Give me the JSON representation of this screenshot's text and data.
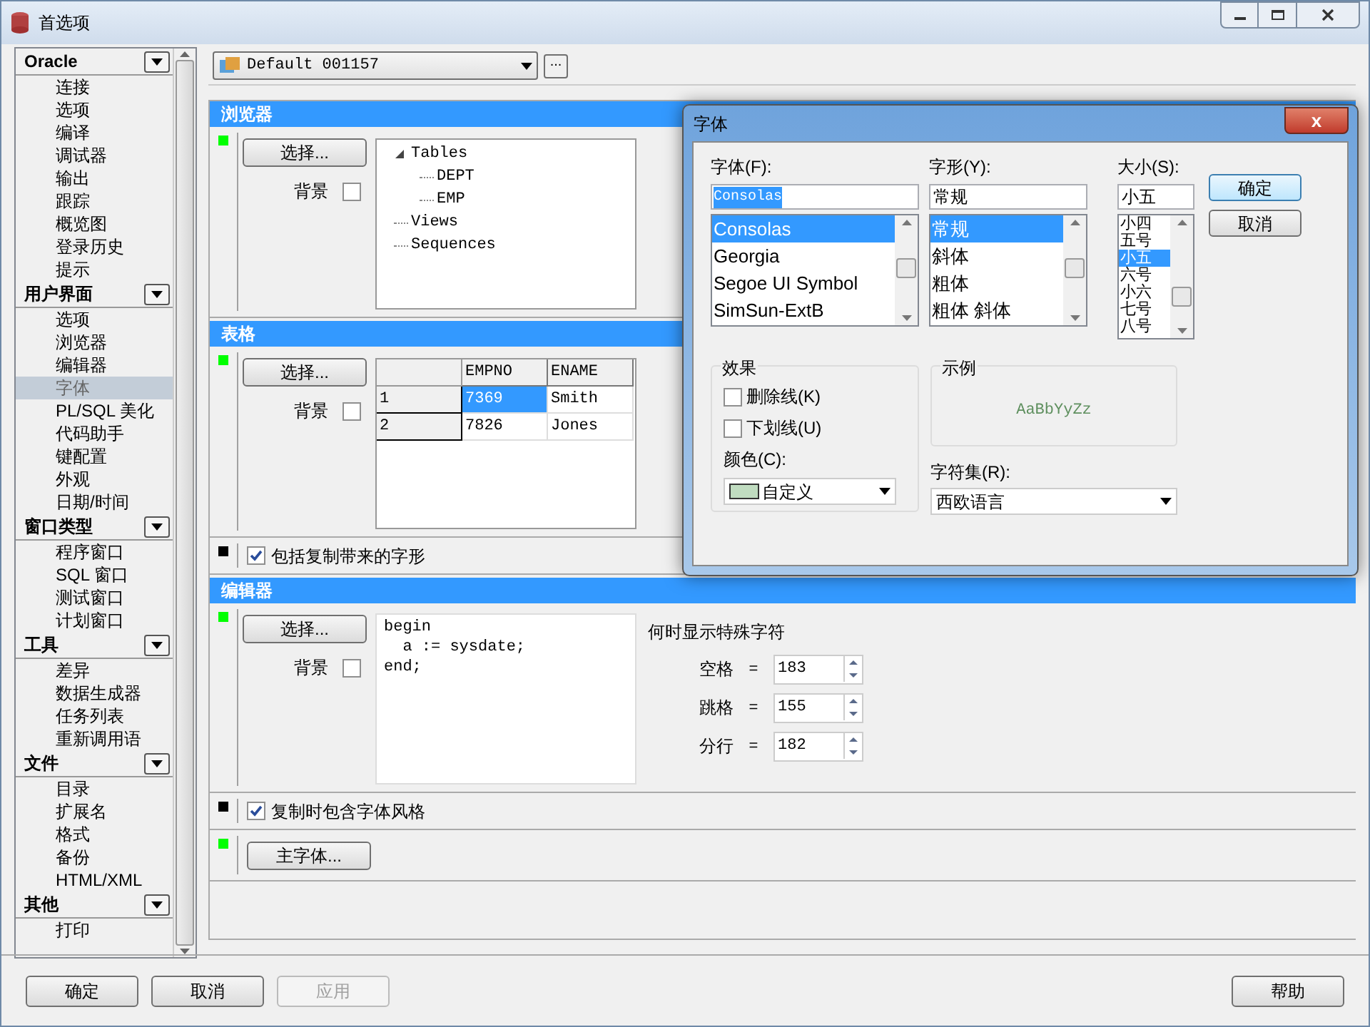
{
  "window": {
    "title": "首选项"
  },
  "sidebar": {
    "groups": [
      {
        "title": "Oracle",
        "expanded": true,
        "items": [
          {
            "label": "连接",
            "selected": false
          },
          {
            "label": "选项",
            "selected": false
          },
          {
            "label": "编译",
            "selected": false
          },
          {
            "label": "调试器",
            "selected": false
          },
          {
            "label": "输出",
            "selected": false
          },
          {
            "label": "跟踪",
            "selected": false
          },
          {
            "label": "概览图",
            "selected": false
          },
          {
            "label": "登录历史",
            "selected": false
          },
          {
            "label": "提示",
            "selected": false
          }
        ]
      },
      {
        "title": "用户界面",
        "expanded": true,
        "items": [
          {
            "label": "选项",
            "selected": false
          },
          {
            "label": "浏览器",
            "selected": false
          },
          {
            "label": "编辑器",
            "selected": false
          },
          {
            "label": "字体",
            "selected": true
          },
          {
            "label": "PL/SQL 美化",
            "selected": false
          },
          {
            "label": "代码助手",
            "selected": false
          },
          {
            "label": "键配置",
            "selected": false
          },
          {
            "label": "外观",
            "selected": false
          },
          {
            "label": "日期/时间",
            "selected": false
          }
        ]
      },
      {
        "title": "窗口类型",
        "expanded": true,
        "items": [
          {
            "label": "程序窗口",
            "selected": false
          },
          {
            "label": "SQL 窗口",
            "selected": false
          },
          {
            "label": "测试窗口",
            "selected": false
          },
          {
            "label": "计划窗口",
            "selected": false
          }
        ]
      },
      {
        "title": "工具",
        "expanded": true,
        "items": [
          {
            "label": "差异",
            "selected": false
          },
          {
            "label": "数据生成器",
            "selected": false
          },
          {
            "label": "任务列表",
            "selected": false
          },
          {
            "label": "重新调用语",
            "selected": false
          }
        ]
      },
      {
        "title": "文件",
        "expanded": true,
        "items": [
          {
            "label": "目录",
            "selected": false
          },
          {
            "label": "扩展名",
            "selected": false
          },
          {
            "label": "格式",
            "selected": false
          },
          {
            "label": "备份",
            "selected": false
          },
          {
            "label": "HTML/XML",
            "selected": false
          }
        ]
      },
      {
        "title": "其他",
        "expanded": true,
        "items": [
          {
            "label": "打印",
            "selected": false
          }
        ]
      }
    ]
  },
  "profile": {
    "value": "Default 001157",
    "more_button": "..."
  },
  "browser": {
    "title": "浏览器",
    "color": "#00ff00",
    "select_button": "选择...",
    "background_label": "背景",
    "background_checked": false,
    "tree": [
      {
        "label": "Tables",
        "expanded": true,
        "children": [
          {
            "label": "DEPT"
          },
          {
            "label": "EMP"
          }
        ]
      },
      {
        "label": "Views"
      },
      {
        "label": "Sequences"
      }
    ]
  },
  "grid": {
    "title": "表格",
    "color": "#00ff00",
    "select_button": "选择...",
    "background_label": "背景",
    "background_checked": false,
    "columns": [
      "EMPNO",
      "ENAME"
    ],
    "rows": [
      {
        "label": "1",
        "cells": [
          {
            "text": "7369",
            "selected": true
          },
          {
            "text": "Smith",
            "selected": false
          }
        ]
      },
      {
        "label": "2",
        "cells": [
          {
            "text": "7826",
            "selected": false
          },
          {
            "text": "Jones",
            "selected": false
          }
        ]
      }
    ]
  },
  "grid_option": {
    "color": "#000000",
    "label": "包括复制带来的字形",
    "checked": true
  },
  "editor": {
    "title": "编辑器",
    "color": "#00ff00",
    "select_button": "选择...",
    "background_label": "背景",
    "background_checked": false,
    "code": [
      "begin",
      "  a := sysdate;",
      "end;"
    ],
    "special_title": "何时显示特殊字符",
    "fields": [
      {
        "label": "空格",
        "sign": "=",
        "value": "183"
      },
      {
        "label": "跳格",
        "sign": "=",
        "value": "155"
      },
      {
        "label": "分行",
        "sign": "=",
        "value": "182"
      }
    ]
  },
  "editor_option": {
    "color": "#000000",
    "label": "复制时包含字体风格",
    "checked": true
  },
  "main_font": {
    "color": "#00ff00",
    "button": "主字体..."
  },
  "footer": {
    "buttons": [
      {
        "label": "确定",
        "disabled": false
      },
      {
        "label": "取消",
        "disabled": false
      },
      {
        "label": "应用",
        "disabled": true
      }
    ],
    "help": "帮助"
  },
  "font_dialog": {
    "title": "字体",
    "close": "x",
    "font": {
      "label": "字体(F):",
      "value": "Consolas",
      "options": [
        {
          "label": "Consolas",
          "selected": true
        },
        {
          "label": "Georgia",
          "selected": false
        },
        {
          "label": "Segoe UI Symbol",
          "selected": false
        },
        {
          "label": "SimSun-ExtB",
          "selected": false
        }
      ]
    },
    "style": {
      "label": "字形(Y):",
      "value": "常规",
      "options": [
        {
          "label": "常规",
          "selected": true
        },
        {
          "label": "斜体",
          "selected": false
        },
        {
          "label": "粗体",
          "selected": false
        },
        {
          "label": "粗体 斜体",
          "selected": false
        }
      ]
    },
    "size": {
      "label": "大小(S):",
      "value": "小五",
      "options": [
        {
          "label": "小四",
          "selected": false
        },
        {
          "label": "五号",
          "selected": false
        },
        {
          "label": "小五",
          "selected": true
        },
        {
          "label": "六号",
          "selected": false
        },
        {
          "label": "小六",
          "selected": false
        },
        {
          "label": "七号",
          "selected": false
        },
        {
          "label": "八号",
          "selected": false
        }
      ]
    },
    "ok": "确定",
    "cancel": "取消",
    "effects": {
      "title": "效果",
      "options": [
        {
          "label": "删除线(K)",
          "checked": false
        },
        {
          "label": "下划线(U)",
          "checked": false
        }
      ],
      "color_label": "颜色(C):",
      "color_value": "自定义",
      "color": "#c0dcc0"
    },
    "sample": {
      "title": "示例",
      "text": "AaBbYyZz"
    },
    "charset": {
      "label": "字符集(R):",
      "value": "西欧语言"
    }
  }
}
